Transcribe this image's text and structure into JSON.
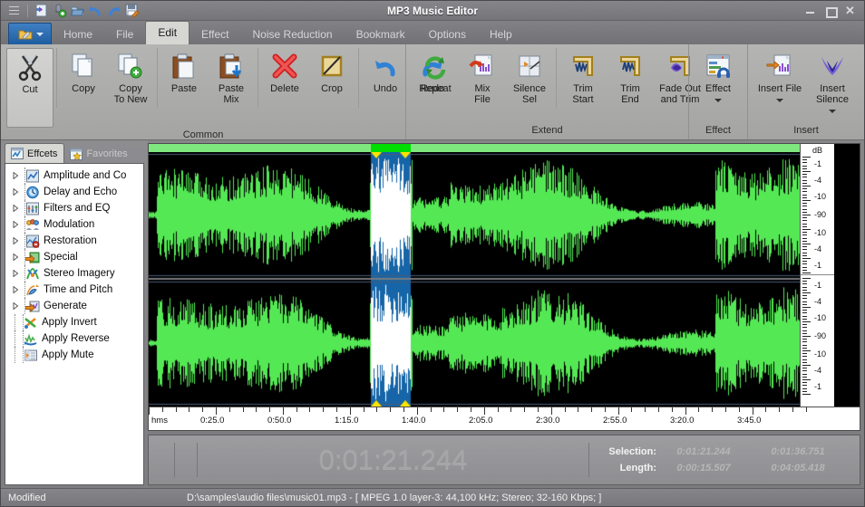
{
  "window": {
    "title": "MP3 Music Editor",
    "controls": {
      "minimize": "minimize",
      "maximize": "maximize",
      "close": "close"
    }
  },
  "quick_access": {
    "items": [
      {
        "name": "app-menu-icon",
        "label": "Menu"
      },
      {
        "name": "new-file-icon",
        "label": "New"
      },
      {
        "name": "record-icon",
        "label": "Record"
      },
      {
        "name": "open-file-icon",
        "label": "Open"
      },
      {
        "name": "undo-icon",
        "label": "Undo"
      },
      {
        "name": "redo-icon",
        "label": "Redo"
      },
      {
        "name": "save-icon",
        "label": "Save"
      }
    ]
  },
  "ribbon": {
    "app_button_label": "",
    "tabs": [
      {
        "label": "Home",
        "active": false
      },
      {
        "label": "File",
        "active": false
      },
      {
        "label": "Edit",
        "active": true
      },
      {
        "label": "Effect",
        "active": false
      },
      {
        "label": "Noise Reduction",
        "active": false
      },
      {
        "label": "Bookmark",
        "active": false
      },
      {
        "label": "Options",
        "active": false
      },
      {
        "label": "Help",
        "active": false
      }
    ],
    "groups": [
      {
        "title": "Common",
        "subgroups": [
          {
            "buttons": [
              {
                "label": "Cut",
                "icon": "scissors-icon",
                "selected": true
              }
            ]
          },
          {
            "buttons": [
              {
                "label": "Copy",
                "icon": "copy-icon"
              },
              {
                "label": "Copy\nTo New",
                "label_line1": "Copy",
                "label_line2": "To New",
                "icon": "copy-to-new-icon"
              }
            ]
          },
          {
            "buttons": [
              {
                "label": "Paste",
                "icon": "paste-icon"
              },
              {
                "label_line1": "Paste",
                "label_line2": "Mix",
                "icon": "paste-mix-icon"
              }
            ]
          },
          {
            "buttons": [
              {
                "label": "Delete",
                "icon": "delete-icon"
              },
              {
                "label": "Crop",
                "icon": "crop-icon"
              }
            ]
          },
          {
            "buttons": [
              {
                "label": "Undo",
                "icon": "undo-arrow-icon"
              },
              {
                "label": "Redo",
                "icon": "redo-arrow-icon"
              }
            ]
          }
        ]
      },
      {
        "title": "Extend",
        "subgroups": [
          {
            "buttons": [
              {
                "label": "Repeat",
                "icon": "repeat-icon"
              },
              {
                "label_line1": "Mix",
                "label_line2": "File",
                "icon": "mix-file-icon"
              },
              {
                "label_line1": "Silence",
                "label_line2": "Sel",
                "icon": "silence-sel-icon"
              }
            ]
          },
          {
            "buttons": [
              {
                "label_line1": "Trim",
                "label_line2": "Start",
                "icon": "trim-start-icon"
              },
              {
                "label_line1": "Trim",
                "label_line2": "End",
                "icon": "trim-end-icon"
              },
              {
                "label_line1": "Fade Out",
                "label_line2": "and Trim",
                "icon": "fade-out-trim-icon"
              }
            ]
          }
        ]
      },
      {
        "title": "Effect",
        "subgroups": [
          {
            "buttons": [
              {
                "label": "Effect",
                "icon": "effect-icon",
                "has_dropdown": true
              }
            ]
          }
        ]
      },
      {
        "title": "Insert",
        "subgroups": [
          {
            "buttons": [
              {
                "label_line1": "Insert File",
                "label_line2": "",
                "icon": "insert-file-icon",
                "has_dropdown": true
              },
              {
                "label_line1": "Insert",
                "label_line2": "Silence",
                "icon": "insert-silence-icon",
                "has_dropdown": true
              }
            ]
          }
        ]
      }
    ]
  },
  "sidebar": {
    "tabs": [
      {
        "label": "Effcets",
        "icon": "effects-tab-icon",
        "active": true
      },
      {
        "label": "Favorites",
        "icon": "favorites-star-icon",
        "active": false
      }
    ],
    "tree": [
      {
        "label": "Amplitude and Co",
        "icon": "amplitude-icon",
        "expandable": true
      },
      {
        "label": "Delay and Echo",
        "icon": "delay-echo-icon",
        "expandable": true
      },
      {
        "label": "Filters and EQ",
        "icon": "filters-eq-icon",
        "expandable": true
      },
      {
        "label": "Modulation",
        "icon": "modulation-icon",
        "expandable": true
      },
      {
        "label": "Restoration",
        "icon": "restoration-icon",
        "expandable": true
      },
      {
        "label": "Special",
        "icon": "special-icon",
        "expandable": true
      },
      {
        "label": "Stereo Imagery",
        "icon": "stereo-imagery-icon",
        "expandable": true
      },
      {
        "label": "Time and Pitch",
        "icon": "time-pitch-icon",
        "expandable": true
      },
      {
        "label": "Generate",
        "icon": "generate-icon",
        "expandable": true
      },
      {
        "label": "Apply Invert",
        "icon": "apply-invert-icon",
        "expandable": false
      },
      {
        "label": "Apply Reverse",
        "icon": "apply-reverse-icon",
        "expandable": false
      },
      {
        "label": "Apply Mute",
        "icon": "apply-mute-icon",
        "expandable": false
      }
    ]
  },
  "waveform": {
    "db_scale_title": "dB",
    "db_ticks": [
      "-1",
      "-4",
      "-10",
      "-90",
      "-10",
      "-4",
      "-1"
    ],
    "ruler_unit": "hms",
    "ruler_labels": [
      "0:25.0",
      "0:50.0",
      "1:15.0",
      "1:40.0",
      "2:05.0",
      "2:30.0",
      "2:55.0",
      "3:20.0",
      "3:45.0"
    ],
    "colors": {
      "wave": "#55e855",
      "background": "#000000",
      "selection": "#1565a8",
      "selection_wave": "#ffffff",
      "overview_bar": "#7ee87e",
      "overview_bar_selection": "#00dd00",
      "handle": "#ffe400"
    },
    "selection_start_ratio": 0.337,
    "selection_end_ratio": 0.398
  },
  "transport": {
    "row1": [
      {
        "name": "play-button",
        "icon": "play-icon"
      },
      {
        "name": "loop-button",
        "icon": "loop-icon"
      },
      {
        "name": "play-selection-button",
        "icon": "play-selection-icon"
      },
      {
        "name": "rewind-button",
        "icon": "rewind-icon"
      },
      {
        "name": "fast-forward-button",
        "icon": "fast-forward-icon"
      }
    ],
    "row2": [
      {
        "name": "stop-button",
        "icon": "stop-icon"
      },
      {
        "name": "pause-button",
        "icon": "pause-icon"
      },
      {
        "name": "record-button",
        "icon": "record-icon"
      },
      {
        "name": "skip-start-button",
        "icon": "skip-to-start-icon"
      },
      {
        "name": "skip-end-button",
        "icon": "skip-to-end-icon"
      }
    ],
    "zoom_row1": [
      {
        "name": "zoom-in-button",
        "icon": "zoom-in-icon"
      },
      {
        "name": "zoom-out-button",
        "icon": "zoom-out-icon"
      },
      {
        "name": "zoom-selection-button",
        "icon": "zoom-selection-icon"
      },
      {
        "name": "zoom-vertical-in-button",
        "icon": "zoom-vertical-in-icon"
      }
    ],
    "zoom_row2": [
      {
        "name": "zoom-to-start-button",
        "icon": "zoom-to-start-icon"
      },
      {
        "name": "zoom-full-button",
        "icon": "zoom-full-icon"
      },
      {
        "name": "zoom-to-end-button",
        "icon": "zoom-to-end-icon"
      },
      {
        "name": "zoom-vertical-out-button",
        "icon": "zoom-vertical-out-icon"
      }
    ],
    "current_time": "0:01:21.244",
    "info": {
      "selection_label": "Selection:",
      "selection_start": "0:01:21.244",
      "selection_end": "0:01:36.751",
      "length_label": "Length:",
      "length_selection": "0:00:15.507",
      "length_total": "0:04:05.418"
    }
  },
  "status_bar": {
    "state": "Modified",
    "file_info": "D:\\samples\\audio files\\music01.mp3 - [ MPEG 1.0 layer-3: 44,100 kHz; Stereo; 32-160 Kbps;  ]"
  }
}
